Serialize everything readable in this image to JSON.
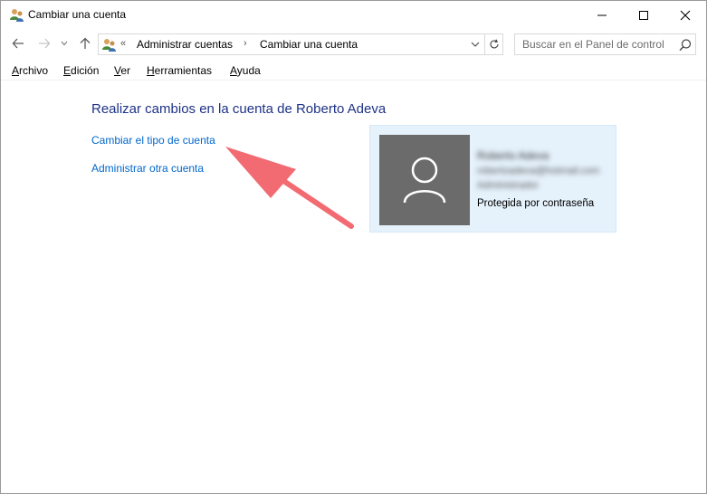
{
  "window": {
    "title": "Cambiar una cuenta",
    "icon": "users-icon"
  },
  "address": {
    "chevron": "«",
    "crumbs": [
      "Administrar cuentas",
      "Cambiar una cuenta"
    ],
    "separator": "›"
  },
  "search": {
    "placeholder": "Buscar en el Panel de control"
  },
  "menu": {
    "items": [
      {
        "first": "A",
        "rest": "rchivo"
      },
      {
        "first": "E",
        "rest": "dición"
      },
      {
        "first": "V",
        "rest": "er"
      },
      {
        "first": "H",
        "rest": "erramientas"
      },
      {
        "first": "A",
        "rest": "yuda"
      }
    ]
  },
  "main": {
    "heading": "Realizar cambios en la cuenta de Roberto Adeva",
    "links": [
      "Cambiar el tipo de cuenta",
      "Administrar otra cuenta"
    ]
  },
  "account": {
    "name": "Roberto Adeva",
    "email": "robertoadeva@hotmail.com",
    "role": "Administrador",
    "status": "Protegida por contraseña"
  },
  "colors": {
    "heading": "#1e3287",
    "link": "#0066cc",
    "card_bg": "#e5f1fb",
    "avatar_bg": "#6b6b6b",
    "annotation_arrow": "#f26b73"
  }
}
